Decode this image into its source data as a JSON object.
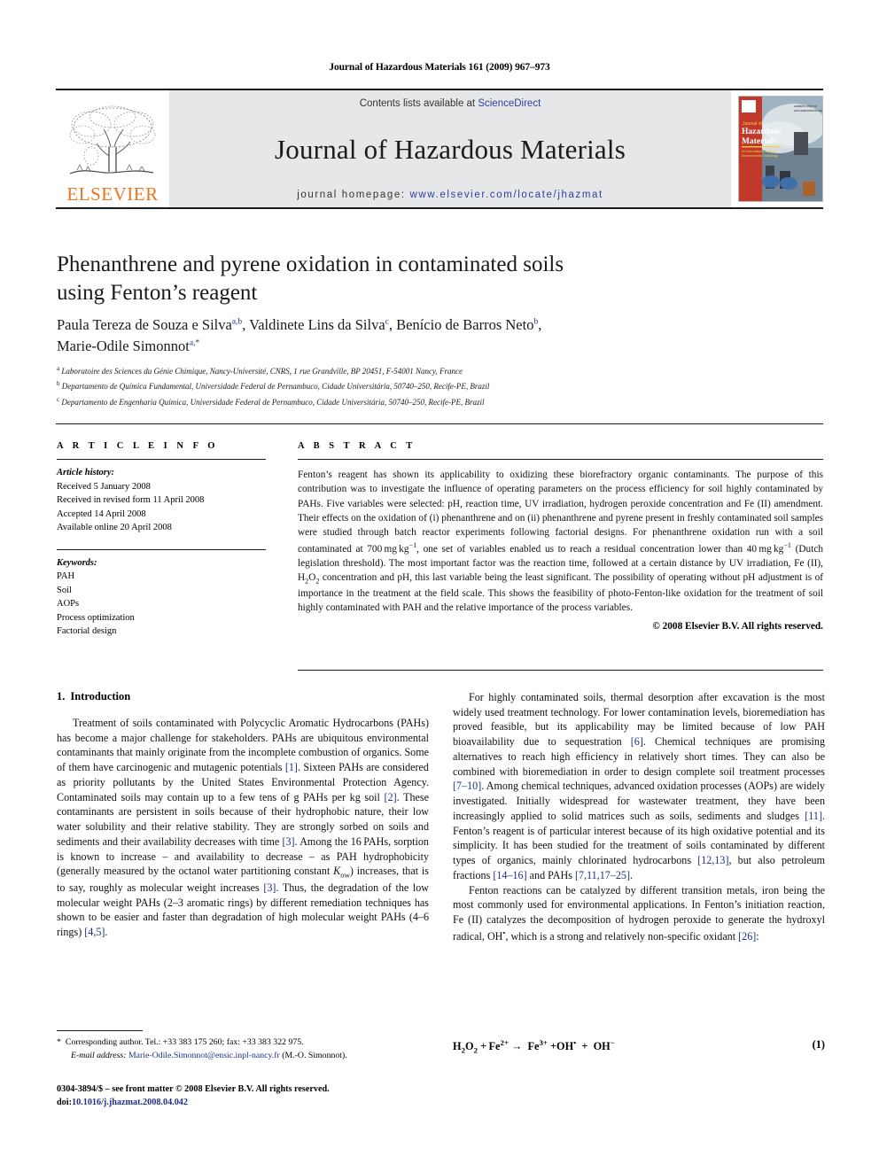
{
  "running_head": "Journal of Hazardous Materials 161 (2009) 967–973",
  "masthead": {
    "contents_prefix": "Contents lists available at ",
    "sciencedirect": "ScienceDirect",
    "journal_name": "Journal of Hazardous Materials",
    "homepage_prefix": "journal homepage:",
    "homepage_url": "www.elsevier.com/locate/jhazmat",
    "publisher": "ELSEVIER",
    "cover_title_line1": "Journal of",
    "cover_title_line2": "Hazardous",
    "cover_title_line3": "Materials"
  },
  "colors": {
    "link": "#2b3f9e",
    "reference": "#1f2f8a",
    "elsevier_orange": "#E87722",
    "band_grey": "#e6e7e9"
  },
  "article": {
    "title_line1": "Phenanthrene and pyrene oxidation in contaminated soils",
    "title_line2": "using Fenton’s reagent",
    "authors": [
      {
        "name": "Paula Tereza de Souza e Silva",
        "marks": "a,b",
        "sep": ", "
      },
      {
        "name": "Valdinete Lins da Silva",
        "marks": "c",
        "sep": ", "
      },
      {
        "name": "Benício de Barros Neto",
        "marks": "b",
        "sep": ", "
      },
      {
        "name": "Marie-Odile Simonnot",
        "marks": "a,*",
        "sep": ""
      }
    ],
    "affiliations": [
      {
        "mark": "a",
        "text": "Laboratoire des Sciences du Génie Chimique, Nancy-Université, CNRS, 1 rue Grandville, BP 20451, F-54001 Nancy, France"
      },
      {
        "mark": "b",
        "text": "Departamento de Química Fundamental, Universidade Federal de Pernambuco, Cidade Universitária, 50740–250, Recife-PE, Brazil"
      },
      {
        "mark": "c",
        "text": "Departamento de Engenharia Química, Universidade Federal de Pernambuco, Cidade Universitária, 50740–250, Recife-PE, Brazil"
      }
    ]
  },
  "article_info": {
    "heading": "A R T I C L E   I N F O",
    "history_label": "Article history:",
    "history": [
      "Received 5 January 2008",
      "Received in revised form 11 April 2008",
      "Accepted 14 April 2008",
      "Available online 20 April 2008"
    ],
    "keywords_label": "Keywords:",
    "keywords": [
      "PAH",
      "Soil",
      "AOPs",
      "Process optimization",
      "Factorial design"
    ]
  },
  "abstract": {
    "heading": "A B S T R A C T",
    "body": "Fenton’s reagent has shown its applicability to oxidizing these biorefractory organic contaminants. The purpose of this contribution was to investigate the influence of operating parameters on the process efficiency for soil highly contaminated by PAHs. Five variables were selected: pH, reaction time, UV irradiation, hydrogen peroxide concentration and Fe (II) amendment. Their effects on the oxidation of (i) phenanthrene and on (ii) phenanthrene and pyrene present in freshly contaminated soil samples were studied through batch reactor experiments following factorial designs. For phenanthrene oxidation run with a soil contaminated at 700 mg kg−1, one set of variables enabled us to reach a residual concentration lower than 40 mg kg−1 (Dutch legislation threshold). The most important factor was the reaction time, followed at a certain distance by UV irradiation, Fe (II), H2O2 concentration and pH, this last variable being the least significant. The possibility of operating without pH adjustment is of importance in the treatment at the field scale. This shows the feasibility of photo-Fenton-like oxidation for the treatment of soil highly contaminated with PAH and the relative importance of the process variables.",
    "copyright": "© 2008 Elsevier B.V. All rights reserved."
  },
  "introduction": {
    "number": "1.",
    "title": "Introduction",
    "p1": "Treatment of soils contaminated with Polycyclic Aromatic Hydrocarbons (PAHs) has become a major challenge for stakeholders. PAHs are ubiquitous environmental contaminants that mainly originate from the incomplete combustion of organics. Some of them have carcinogenic and mutagenic potentials [1]. Sixteen PAHs are considered as priority pollutants by the United States Environmental Protection Agency. Contaminated soils may contain up to a few tens of g PAHs per kg soil [2]. These contaminants are persistent in soils because of their hydrophobic nature, their low water solubility and their relative stability. They are strongly sorbed on soils and sediments and their availability decreases with time [3]. Among the 16 PAHs, sorption is known to increase – and availability to decrease – as PAH hydrophobicity (generally measured by the octanol water partitioning constant Kow) increases, that is to say, roughly as molecular weight increases [3]. Thus, the degradation of the low molecular weight PAHs (2–3 aromatic rings) by different remediation techniques has shown to be easier and faster than degradation of high molecular weight PAHs (4–6 rings) [4,5].",
    "p2": "For highly contaminated soils, thermal desorption after excavation is the most widely used treatment technology. For lower contamination levels, bioremediation has proved feasible, but its applicability may be limited because of low PAH bioavailability due to sequestration [6]. Chemical techniques are promising alternatives to reach high efficiency in relatively short times. They can also be combined with bioremediation in order to design complete soil treatment processes [7–10]. Among chemical techniques, advanced oxidation processes (AOPs) are widely investigated. Initially widespread for wastewater treatment, they have been increasingly applied to solid matrices such as soils, sediments and sludges [11]. Fenton’s reagent is of particular interest because of its high oxidative potential and its simplicity. It has been studied for the treatment of soils contaminated by different types of organics, mainly chlorinated hydrocarbons [12,13], but also petroleum fractions [14–16] and PAHs [7,11,17–25].",
    "p3": "Fenton reactions can be catalyzed by different transition metals, iron being the most commonly used for environmental applications. In Fenton’s initiation reaction, Fe (II) catalyzes the decomposition of hydrogen peroxide to generate the hydroxyl radical, OH•, which is a strong and relatively non-specific oxidant [26]:"
  },
  "equation": {
    "text": "H2O2 + Fe2+ →  Fe3+ + OH• +  OH−",
    "number": "(1)"
  },
  "footnote": {
    "star": "*",
    "line1": "Corresponding author. Tel.: +33 383 175 260; fax: +33 383 322 975.",
    "email_label": "E-mail address:",
    "email": "Marie-Odile.Simonnot@ensic.inpl-nancy.fr",
    "email_suffix": "(M.-O. Simonnot)."
  },
  "imprint": {
    "line1": "0304-3894/$ – see front matter © 2008 Elsevier B.V. All rights reserved.",
    "doi_label": "doi:",
    "doi": "10.1016/j.jhazmat.2008.04.042"
  }
}
